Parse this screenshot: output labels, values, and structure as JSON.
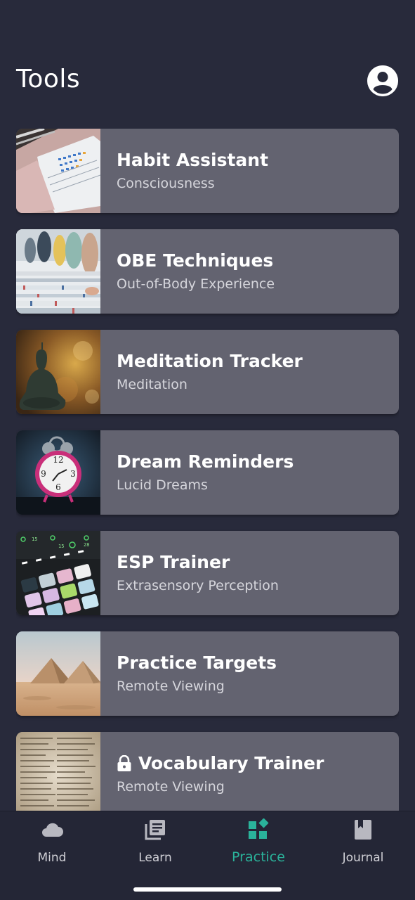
{
  "header": {
    "title": "Tools"
  },
  "tools": [
    {
      "title": "Habit Assistant",
      "subtitle": "Consciousness",
      "thumbnail": "notebook-photo",
      "locked": false
    },
    {
      "title": "OBE Techniques",
      "subtitle": "Out-of-Body Experience",
      "thumbnail": "record-store-photo",
      "locked": false
    },
    {
      "title": "Meditation Tracker",
      "subtitle": "Meditation",
      "thumbnail": "buddha-statue-photo",
      "locked": false
    },
    {
      "title": "Dream Reminders",
      "subtitle": "Lucid Dreams",
      "thumbnail": "alarm-clock-photo",
      "locked": false
    },
    {
      "title": "ESP Trainer",
      "subtitle": "Extrasensory Perception",
      "thumbnail": "launchpad-photo",
      "locked": false
    },
    {
      "title": "Practice Targets",
      "subtitle": "Remote Viewing",
      "thumbnail": "pyramids-photo",
      "locked": false
    },
    {
      "title": "Vocabulary Trainer",
      "subtitle": "Remote Viewing",
      "thumbnail": "dictionary-photo",
      "locked": true
    }
  ],
  "nav": [
    {
      "label": "Mind",
      "icon": "cloud-icon",
      "active": false
    },
    {
      "label": "Learn",
      "icon": "library-books-icon",
      "active": false
    },
    {
      "label": "Practice",
      "icon": "widgets-icon",
      "active": true
    },
    {
      "label": "Journal",
      "icon": "book-icon",
      "active": false
    }
  ],
  "colors": {
    "background": "#282a3b",
    "card": "#636370",
    "nav_background": "#242636",
    "accent": "#2ab39b"
  }
}
